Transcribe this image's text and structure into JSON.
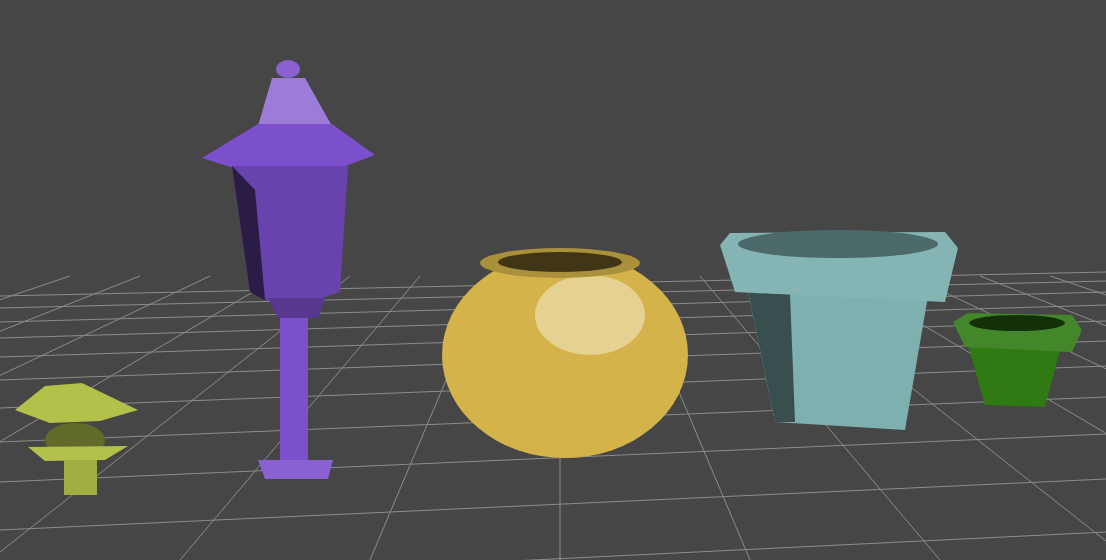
{
  "viewport": {
    "objects": [
      {
        "kind": "garden-lantern",
        "color": "#b3c14a"
      },
      {
        "kind": "street-lamp",
        "color": "#7c4fcc"
      },
      {
        "kind": "round-pot",
        "color": "#d4b44a"
      },
      {
        "kind": "flower-pot",
        "color": "#7fb0b0"
      },
      {
        "kind": "small-pot",
        "color": "#2f7a12"
      }
    ]
  }
}
